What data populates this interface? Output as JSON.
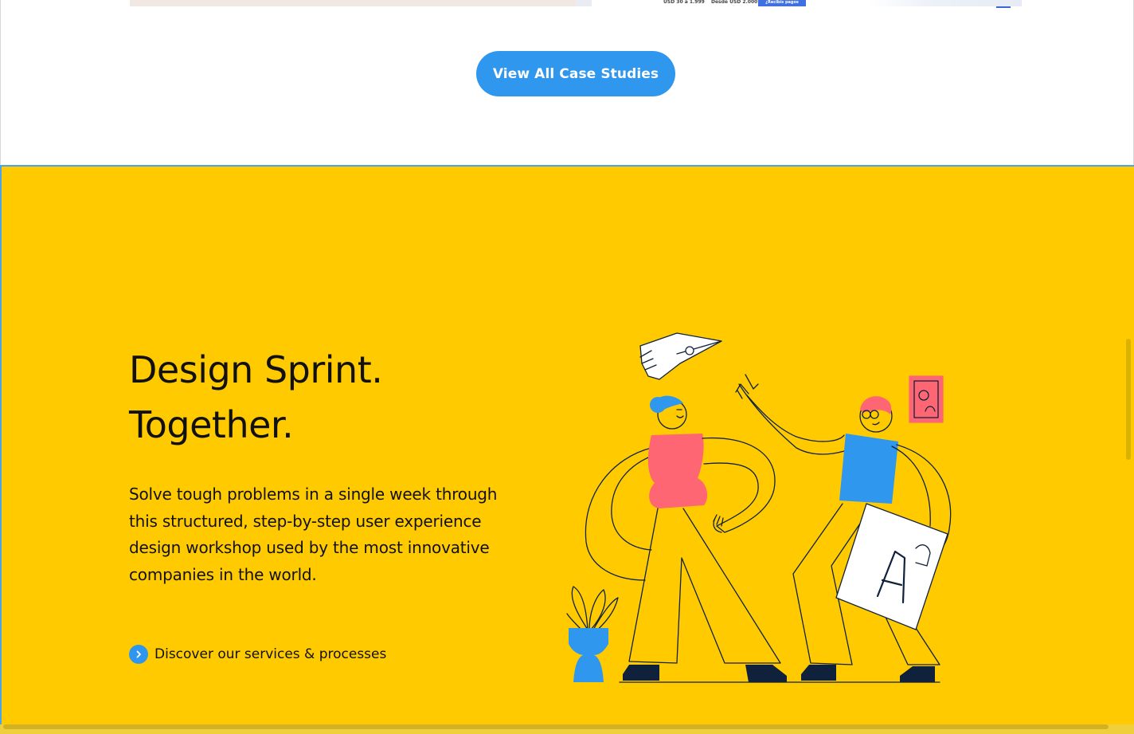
{
  "top": {
    "thumbnail_texts": {
      "price_a": "USD 30 a 1.999",
      "price_b": "Desde USD 2.000",
      "payment_badge": "¿Recibís pagos"
    },
    "cta_button_label": "View All Case Studies"
  },
  "sprint": {
    "headline_line1": "Design Sprint.",
    "headline_line2": "Together.",
    "description": "Solve tough problems in a single week through this structured, step-by-step user experience design workshop used by the most innovative companies in the world.",
    "link_label": "Discover our services & processes"
  },
  "colors": {
    "yellow_background": "#ffcb00",
    "accent_blue": "#3097ef",
    "figure_pink": "#ff6673",
    "ink": "#111111"
  },
  "icons": {
    "link_icon": "chevron-right-icon"
  }
}
